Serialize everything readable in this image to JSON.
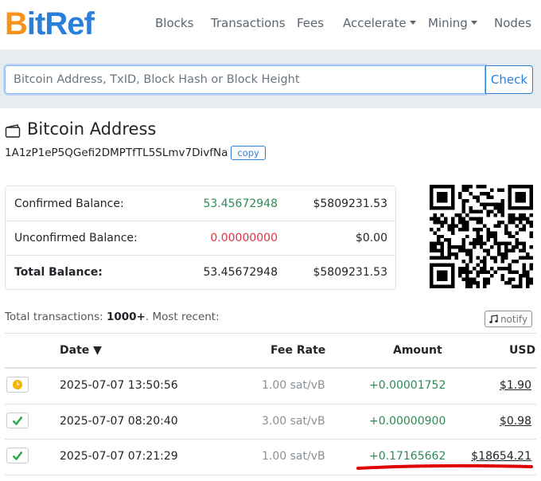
{
  "brand": {
    "logo_orange": "B",
    "logo_blue": "itRef",
    "orange": "#f7931a",
    "blue": "#2a7fdb"
  },
  "nav": {
    "items": [
      {
        "label": "Blocks",
        "dropdown": false
      },
      {
        "label": "Transactions",
        "dropdown": false
      },
      {
        "label": "Fees",
        "dropdown": false
      },
      {
        "label": "Accelerate",
        "dropdown": true
      },
      {
        "label": "Mining",
        "dropdown": true
      },
      {
        "label": "Nodes",
        "dropdown": false
      }
    ]
  },
  "search": {
    "placeholder": "Bitcoin Address, TxID, Block Hash or Block Height",
    "button_label": "Check"
  },
  "address": {
    "title": "Bitcoin Address",
    "value": "1A1zP1eP5QGefi2DMPTfTL5SLmv7DivfNa",
    "copy_label": "copy",
    "icon": "wallet-icon"
  },
  "balances": {
    "confirmed": {
      "label": "Confirmed Balance:",
      "btc": "53.45672948",
      "usd": "$5809231.53"
    },
    "unconfirmed": {
      "label": "Unconfirmed Balance:",
      "btc": "0.00000000",
      "usd": "$0.00"
    },
    "total": {
      "label": "Total Balance:",
      "btc": "53.45672948",
      "usd": "$5809231.53"
    }
  },
  "transactions": {
    "summary_prefix": "Total transactions: ",
    "summary_count": "1000+",
    "summary_suffix": ". Most recent:",
    "notify_label": "notify",
    "headers": {
      "date": "Date ▼",
      "fee": "Fee Rate",
      "amount": "Amount",
      "usd": "USD"
    },
    "rows": [
      {
        "status": "pending",
        "status_icon": "clock-icon",
        "date": "2025-07-07 13:50:56",
        "fee": "1.00 sat/vB",
        "amount": "+0.00001752",
        "usd": "$1.90"
      },
      {
        "status": "confirmed",
        "status_icon": "check-icon",
        "date": "2025-07-07 08:20:40",
        "fee": "3.00 sat/vB",
        "amount": "+0.00000900",
        "usd": "$0.98"
      },
      {
        "status": "confirmed",
        "status_icon": "check-icon",
        "date": "2025-07-07 07:21:29",
        "fee": "1.00 sat/vB",
        "amount": "+0.17165662",
        "usd": "$18654.21"
      }
    ]
  },
  "colors": {
    "positive": "#2e8b57",
    "negative": "#dc3545",
    "annotation": "#e00000"
  }
}
